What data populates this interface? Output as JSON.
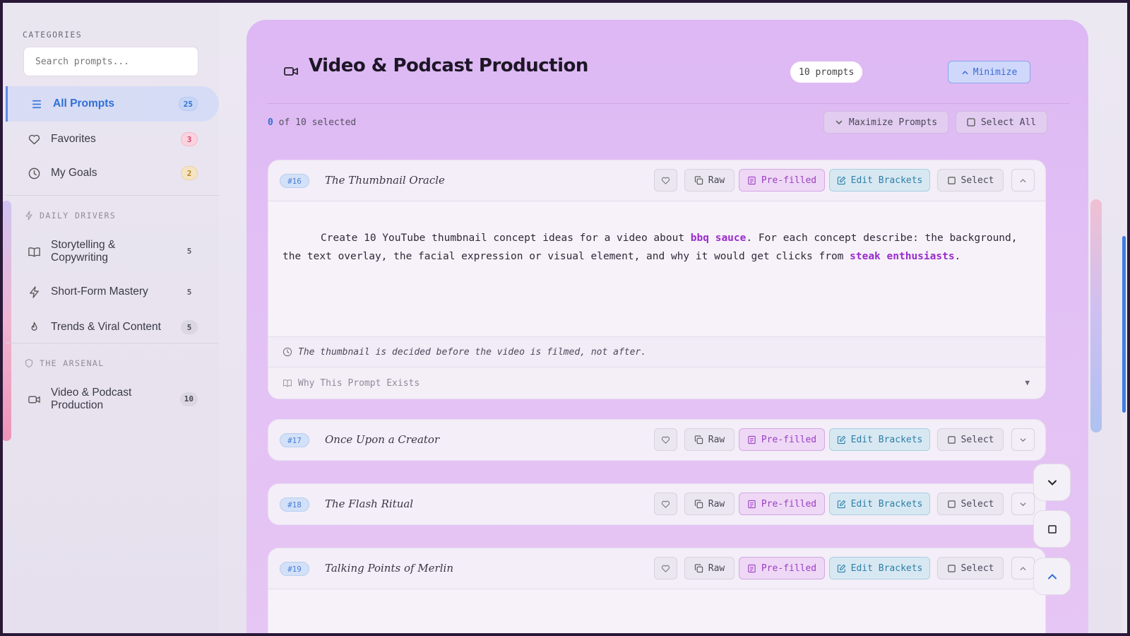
{
  "sidebar": {
    "categories_label": "CATEGORIES",
    "search_placeholder": "Search prompts...",
    "top_items": [
      {
        "label": "All Prompts",
        "count": "25"
      },
      {
        "label": "Favorites",
        "count": "3"
      },
      {
        "label": "My Goals",
        "count": "2"
      }
    ],
    "sections": [
      {
        "label": "DAILY DRIVERS",
        "items": [
          {
            "label": "Storytelling & Copywriting",
            "count": "5"
          },
          {
            "label": "Short-Form Mastery",
            "count": "5"
          },
          {
            "label": "Trends & Viral Content",
            "count": "5"
          }
        ]
      },
      {
        "label": "THE ARSENAL",
        "items": [
          {
            "label": "Video & Podcast Production",
            "count": "10"
          }
        ]
      }
    ]
  },
  "main": {
    "title": "Video & Podcast Production",
    "prompt_count": "10 prompts",
    "minimize_label": "Minimize",
    "selected_num": "0",
    "selected_suffix": " of 10 selected",
    "maximize_label": "Maximize Prompts",
    "select_all_label": "Select All",
    "actions": {
      "raw": "Raw",
      "prefilled": "Pre-filled",
      "edit": "Edit Brackets",
      "select": "Select"
    },
    "cards": [
      {
        "number": "#16",
        "title": "The Thumbnail Oracle",
        "expanded": true,
        "body": {
          "t1": "Create 10 YouTube thumbnail concept ideas for a video about ",
          "h1": "bbq sauce",
          "t2": ". For each concept describe: the background, the text overlay, the facial expression or visual element, and why it would get clicks from ",
          "h2": "steak enthusiasts",
          "t3": "."
        },
        "note": "The thumbnail is decided before the video is filmed, not after.",
        "why_label": "Why This Prompt Exists"
      },
      {
        "number": "#17",
        "title": "Once Upon a Creator",
        "expanded": false
      },
      {
        "number": "#18",
        "title": "The Flash Ritual",
        "expanded": false
      },
      {
        "number": "#19",
        "title": "Talking Points of Merlin",
        "expanded": true
      }
    ]
  },
  "colors": {
    "accent_blue": "#2f6fd6",
    "highlight_purple": "#9a2ccc",
    "panel_purple": "#ddb8f4"
  }
}
